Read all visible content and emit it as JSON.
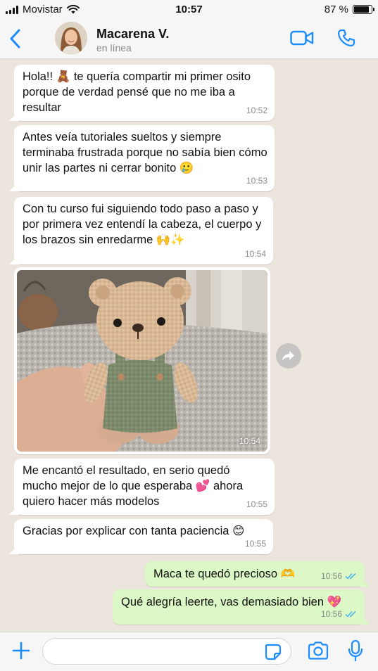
{
  "status_bar": {
    "carrier": "Movistar",
    "time": "10:57",
    "battery_label": "87 %",
    "battery_level": 0.87
  },
  "header": {
    "contact_name": "Macarena V.",
    "contact_status": "en línea",
    "icons": [
      "chevron-left-icon",
      "video-camera-icon",
      "phone-icon"
    ]
  },
  "messages": [
    {
      "direction": "in",
      "text": "Hola!! 🧸 te quería compartir mi primer osito porque de verdad pensé que no me iba a resultar",
      "time": "10:52"
    },
    {
      "direction": "in",
      "text": "Antes veía tutoriales sueltos y siempre terminaba frustrada porque no sabía bien cómo unir las partes ni cerrar bonito 🥲",
      "time": "10:53"
    },
    {
      "direction": "in",
      "text": "Con tu curso fui siguiendo todo paso a paso y por primera vez entendí la cabeza, el cuerpo y los brazos sin enredarme 🙌✨",
      "time": "10:54"
    },
    {
      "direction": "in",
      "type": "photo",
      "time": "10:54"
    },
    {
      "direction": "in",
      "text": "Me encantó el resultado, en serio quedó mucho mejor de lo que esperaba 💕 ahora quiero hacer más modelos",
      "time": "10:55"
    },
    {
      "direction": "in",
      "text": "Gracias por explicar con tanta paciencia 😊",
      "time": "10:55"
    },
    {
      "direction": "out",
      "text": "Maca te quedó precioso 🫶",
      "time": "10:56",
      "status": "read"
    },
    {
      "direction": "out",
      "text": "Qué alegría leerte, vas demasiado bien 💖",
      "time": "10:56",
      "status": "read"
    }
  ],
  "input_bar": {
    "placeholder": "",
    "icons": [
      "plus-icon",
      "sticker-icon",
      "camera-icon",
      "microphone-icon"
    ]
  },
  "colors": {
    "accent": "#1a8cff",
    "chat_background": "#ece5dd",
    "incoming_bubble": "#ffffff",
    "outgoing_bubble": "#dcf8c6",
    "read_ticks": "#4fb6ec"
  }
}
